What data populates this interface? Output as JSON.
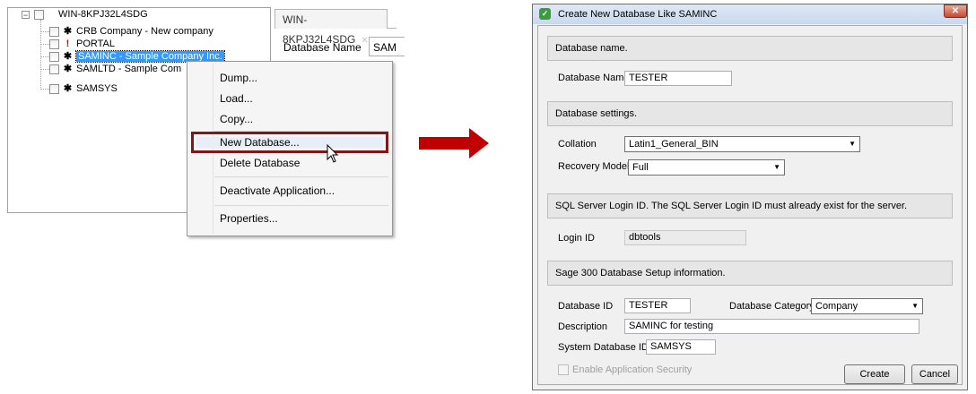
{
  "tree": {
    "root": "WIN-8KPJ32L4SDG",
    "items": [
      {
        "label": "CRB Company - New company",
        "icon": "gear-icon"
      },
      {
        "label": "PORTAL",
        "icon": "exclamation-icon"
      },
      {
        "label": "SAMINC - Sample Company Inc.",
        "icon": "gear-icon"
      },
      {
        "label": "SAMLTD - Sample Com",
        "icon": "gear-icon"
      },
      {
        "label": "SAMSYS",
        "icon": "gear-icon"
      }
    ],
    "expander": "−"
  },
  "tab": {
    "label": "WIN-8KPJ32L4SDG",
    "close": "✕"
  },
  "db_panel": {
    "label": "Database Name",
    "value": "SAM"
  },
  "context_menu": {
    "items": [
      "Dump...",
      "Load...",
      "Copy...",
      "New Database...",
      "Delete Database",
      "Deactivate Application...",
      "Properties..."
    ],
    "highlighted": "New Database..."
  },
  "arrow": {
    "color": "#c00000"
  },
  "dialog": {
    "title": "Create New Database Like SAMINC",
    "sections": {
      "name": "Database name.",
      "settings": "Database settings.",
      "login": "SQL Server Login ID.  The SQL Server Login ID must already exist for the server.",
      "setup": "Sage 300 Database Setup information."
    },
    "database_name": {
      "label": "Database Name",
      "value": "TESTER"
    },
    "collation": {
      "label": "Collation",
      "value": "Latin1_General_BIN"
    },
    "recovery_model": {
      "label": "Recovery Model",
      "value": "Full"
    },
    "login_id": {
      "label": "Login ID",
      "value": "dbtools"
    },
    "database_id": {
      "label": "Database ID",
      "value": "TESTER"
    },
    "database_category": {
      "label": "Database Category",
      "value": "Company"
    },
    "description": {
      "label": "Description",
      "value": "SAMINC for testing"
    },
    "system_database_id": {
      "label": "System Database ID",
      "value": "SAMSYS"
    },
    "enable_security": {
      "label": "Enable Application Security",
      "checked": false,
      "enabled": false
    },
    "buttons": {
      "create": "Create",
      "cancel": "Cancel"
    }
  }
}
